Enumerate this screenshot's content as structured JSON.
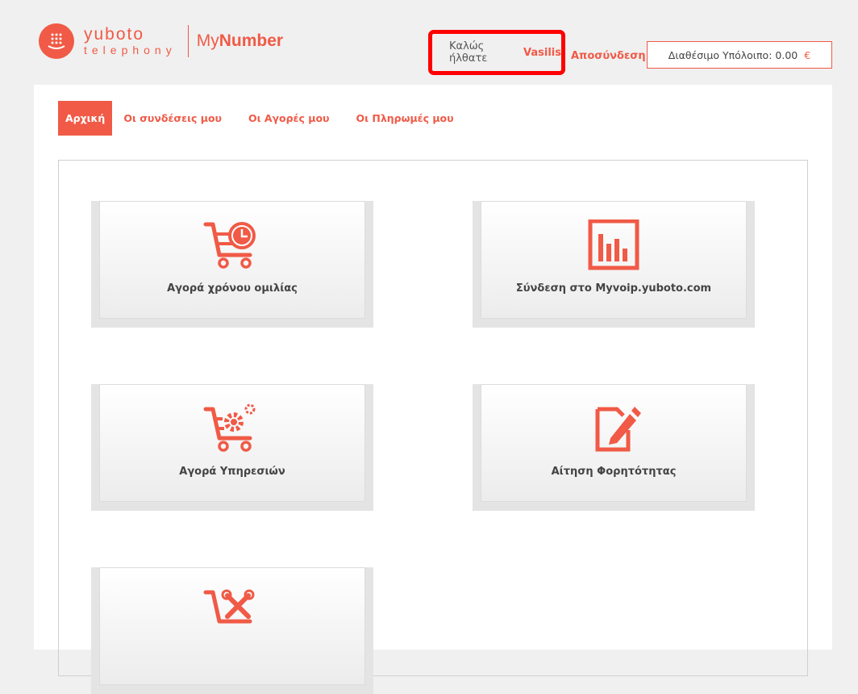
{
  "brand": {
    "logo_word": "yuboto",
    "logo_sub": "telephony",
    "product_prefix": "My",
    "product_suffix": "Number"
  },
  "header": {
    "welcome_text": "Καλώς ήλθατε",
    "username": "Vasilis",
    "logout_label": "Αποσύνδεση",
    "balance_label": "Διαθέσιμο Υπόλοιπο: 0.00",
    "currency": "€"
  },
  "nav": {
    "tabs": [
      {
        "label": "Αρχική",
        "active": true
      },
      {
        "label": "Οι συνδέσεις μου",
        "active": false
      },
      {
        "label": "Οι Αγορές μου",
        "active": false
      },
      {
        "label": "Οι Πληρωμές μου",
        "active": false
      }
    ]
  },
  "cards": [
    {
      "label": "Αγορά χρόνου ομιλίας",
      "icon": "cart-clock-icon"
    },
    {
      "label": "Σύνδεση στο Myvoip.yuboto.com",
      "icon": "chart-icon"
    },
    {
      "label": "Αγορά Υπηρεσιών",
      "icon": "cart-gear-icon"
    },
    {
      "label": "Αίτηση Φορητότητας",
      "icon": "document-edit-icon"
    },
    {
      "label": "",
      "icon": "cart-tools-icon"
    }
  ],
  "colors": {
    "accent": "#f05a46",
    "highlight_border": "#ff0000"
  }
}
